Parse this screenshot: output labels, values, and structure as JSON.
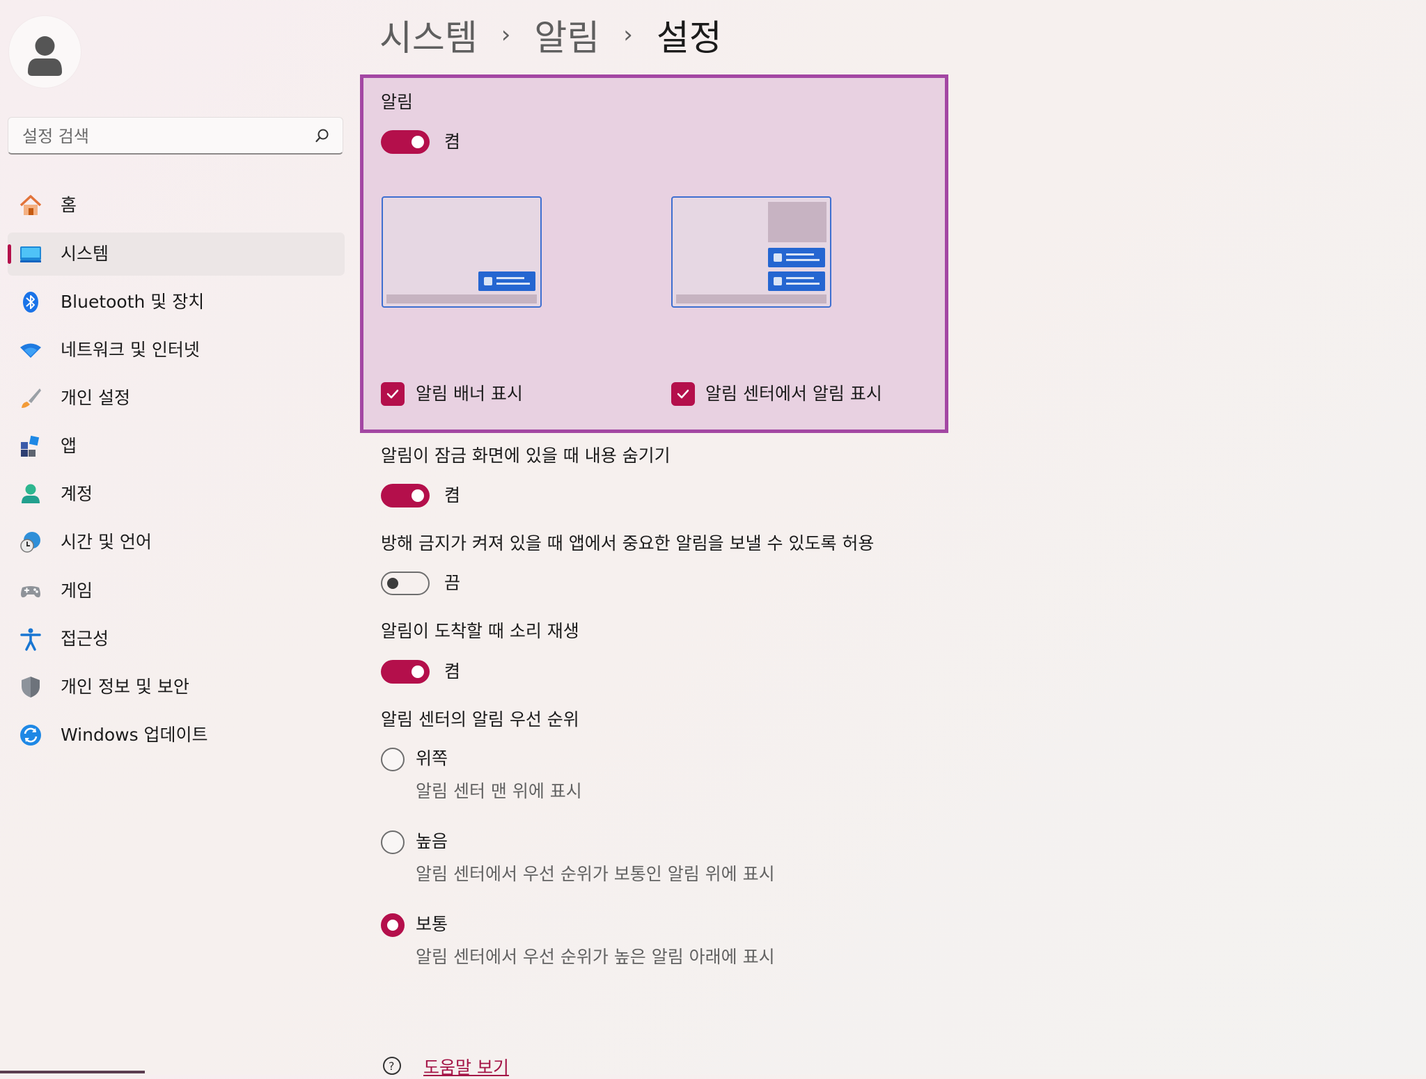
{
  "breadcrumb": [
    "시스템",
    "알림",
    "설정"
  ],
  "search": {
    "placeholder": "설정 검색",
    "icon": "search-icon"
  },
  "sidebar": {
    "items": [
      {
        "label": "홈",
        "icon": "home-icon"
      },
      {
        "label": "시스템",
        "icon": "system-display-icon",
        "active": true
      },
      {
        "label": "Bluetooth 및 장치",
        "icon": "bluetooth-icon"
      },
      {
        "label": "네트워크 및 인터넷",
        "icon": "wifi-icon"
      },
      {
        "label": "개인 설정",
        "icon": "paintbrush-icon"
      },
      {
        "label": "앱",
        "icon": "apps-icon"
      },
      {
        "label": "계정",
        "icon": "account-icon"
      },
      {
        "label": "시간 및 언어",
        "icon": "time-language-icon"
      },
      {
        "label": "게임",
        "icon": "gamepad-icon"
      },
      {
        "label": "접근성",
        "icon": "accessibility-icon"
      },
      {
        "label": "개인 정보 및 보안",
        "icon": "shield-icon"
      },
      {
        "label": "Windows 업데이트",
        "icon": "windows-update-icon"
      }
    ]
  },
  "notifications": {
    "title": "알림",
    "toggle_state": "켬",
    "toggle_on": true,
    "banner_checkbox": {
      "label": "알림 배너 표시",
      "checked": true
    },
    "center_checkbox": {
      "label": "알림 센터에서 알림 표시",
      "checked": true
    }
  },
  "settings": [
    {
      "label": "알림이 잠금 화면에 있을 때 내용 숨기기",
      "state": "켬",
      "on": true
    },
    {
      "label": "방해 금지가 켜져 있을 때 앱에서 중요한 알림을 보낼 수 있도록 허용",
      "state": "끔",
      "on": false
    },
    {
      "label": "알림이 도착할 때 소리 재생",
      "state": "켬",
      "on": true
    }
  ],
  "priority": {
    "title": "알림 센터의 알림 우선 순위",
    "options": [
      {
        "label": "위쪽",
        "description": "알림 센터 맨 위에 표시",
        "checked": false
      },
      {
        "label": "높음",
        "description": "알림 센터에서 우선 순위가 보통인 알림 위에 표시",
        "checked": false
      },
      {
        "label": "보통",
        "description": "알림 센터에서 우선 순위가 높은 알림 아래에 표시",
        "checked": true
      }
    ]
  },
  "help": {
    "label": "도움말 보기",
    "icon": "help-icon"
  },
  "colors": {
    "accent": "#b40f4b",
    "highlight_border": "#a347a3",
    "highlight_fill": "#e8d1e1"
  }
}
